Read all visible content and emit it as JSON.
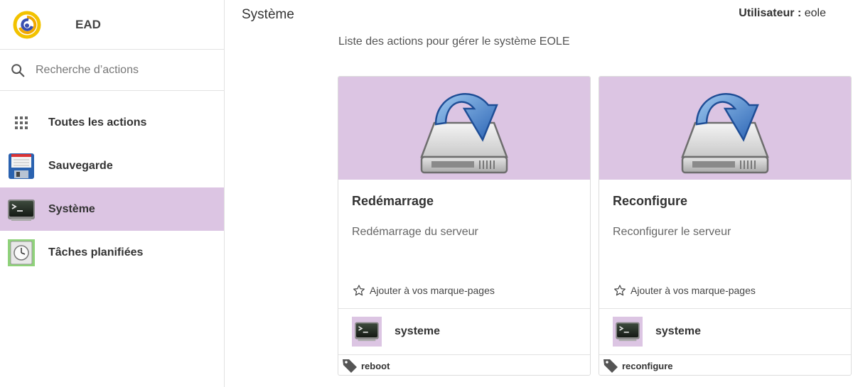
{
  "brand": {
    "name": "EAD",
    "logo_icon": "eole-spiral-logo"
  },
  "search": {
    "placeholder": "Recherche d’actions"
  },
  "sidebar": {
    "items": [
      {
        "label": "Toutes les actions",
        "icon": "grid-icon",
        "active": false
      },
      {
        "label": "Sauvegarde",
        "icon": "floppy-disk-icon",
        "active": false
      },
      {
        "label": "Système",
        "icon": "terminal-icon",
        "active": true
      },
      {
        "label": "Tâches planifiées",
        "icon": "clock-icon",
        "active": false
      }
    ]
  },
  "header": {
    "title": "Système",
    "user_label": "Utilisateur :",
    "user_name": "eole"
  },
  "main": {
    "subtitle": "Liste des actions pour gérer le système EOLE",
    "cards": [
      {
        "title": "Redémarrage",
        "description": "Redémarrage du serveur",
        "bookmark": "Ajouter à vos marque-pages",
        "category": "systeme",
        "tag": "reboot",
        "hero_icon": "drive-install-icon"
      },
      {
        "title": "Reconfigure",
        "description": "Reconfigurer le serveur",
        "bookmark": "Ajouter à vos marque-pages",
        "category": "systeme",
        "tag": "reconfigure",
        "hero_icon": "drive-install-icon"
      }
    ]
  },
  "colors": {
    "accent": "#dcc5e3",
    "border": "#e2e2e2",
    "logo_yellow": "#f2c200"
  }
}
